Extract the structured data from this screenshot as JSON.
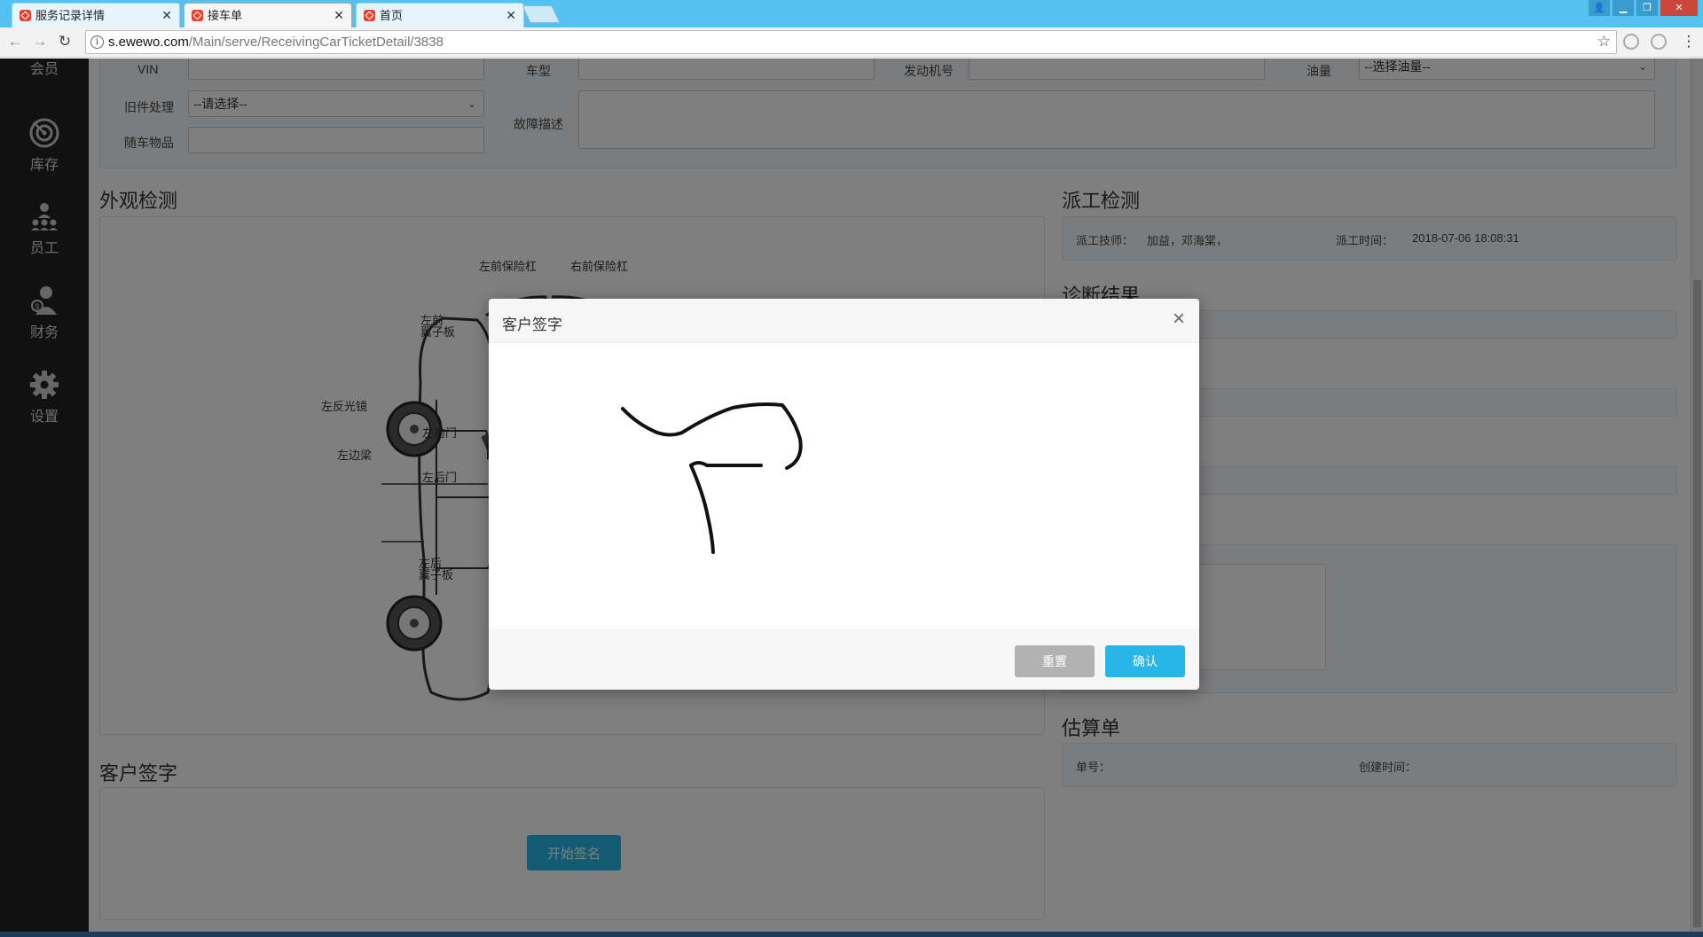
{
  "browser": {
    "tabs": [
      {
        "label": "服务记录详情",
        "active": false
      },
      {
        "label": "接车单",
        "active": true
      },
      {
        "label": "首页",
        "active": false
      }
    ],
    "url_host": "s.ewewo.com",
    "url_path": "/Main/serve/ReceivingCarTicketDetail/3838"
  },
  "sidebar": {
    "items": [
      {
        "label": "会员",
        "icon": "member-icon"
      },
      {
        "label": "库存",
        "icon": "target-icon"
      },
      {
        "label": "员工",
        "icon": "staff-icon"
      },
      {
        "label": "财务",
        "icon": "finance-icon"
      },
      {
        "label": "设置",
        "icon": "gear-icon"
      }
    ]
  },
  "vehicle_form": {
    "vin_label": "VIN",
    "vin_value": "",
    "model_label": "车型",
    "model_value": "",
    "engine_label": "发动机号",
    "engine_value": "",
    "fuel_label": "油量",
    "fuel_value": "--选择油量--",
    "old_parts_label": "旧件处理",
    "old_parts_value": "--请选择--",
    "fault_label": "故障描述",
    "fault_value": "",
    "items_label": "随车物品",
    "items_value": ""
  },
  "appearance": {
    "title": "外观检测",
    "labels": {
      "front_left_bumper": "左前保险杠",
      "front_right_bumper": "右前保险杠",
      "left_front_fender": "左前\n翼子板",
      "left_mirror": "左反光镜",
      "left_front_door": "左前门",
      "left_sill": "左边梁",
      "left_rear_door": "左后门",
      "left_rear_fender": "左后\n翼子板"
    }
  },
  "dispatch": {
    "title": "派工检测",
    "tech_label": "派工技师：",
    "tech_value": "加益，邓海棠，",
    "time_label": "派工时间：",
    "time_value": "2018-07-06 18:08:31"
  },
  "diagnosis": {
    "title": "诊断结果"
  },
  "estimate": {
    "title": "估算单",
    "no_label": "单号：",
    "no_value": "",
    "created_label": "创建时间：",
    "created_value": ""
  },
  "customer_signature": {
    "title": "客户签字",
    "start_button": "开始签名"
  },
  "modal": {
    "title": "客户签字",
    "close": "×",
    "reset_button": "重置",
    "confirm_button": "确认"
  },
  "colors": {
    "primary": "#27b6e6",
    "reset_gray": "#b2b2b2",
    "sidebar_bg": "#222222",
    "tabstrip": "#53c2f0"
  }
}
